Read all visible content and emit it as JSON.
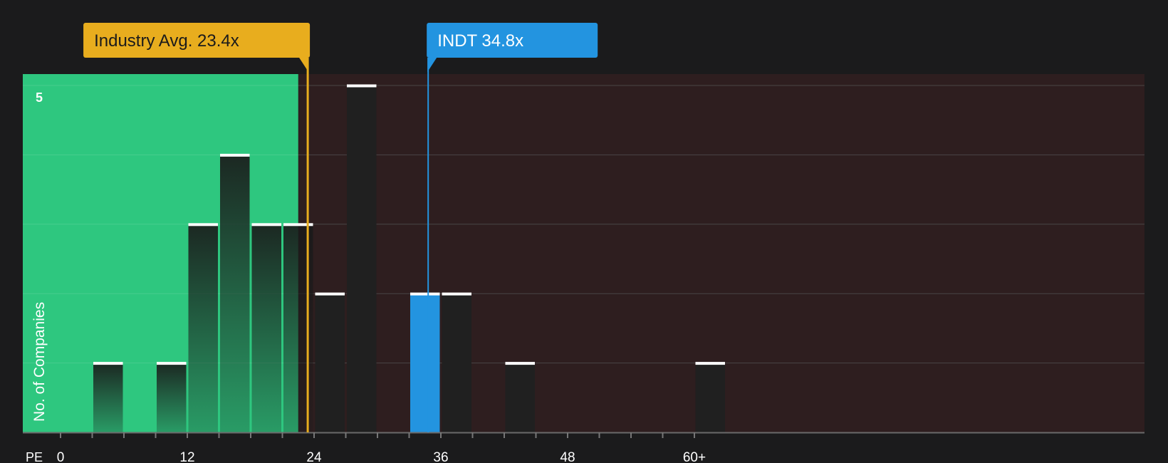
{
  "chart_data": {
    "type": "bar",
    "ylabel": "No. of Companies",
    "xaxis_prefix": "PE",
    "x_ticks": [
      {
        "value": 0,
        "label": "0"
      },
      {
        "value": 12,
        "label": "12"
      },
      {
        "value": 24,
        "label": "24"
      },
      {
        "value": 36,
        "label": "36"
      },
      {
        "value": 48,
        "label": "48"
      },
      {
        "value": 60,
        "label": "60+"
      }
    ],
    "y_ticks": [
      {
        "value": 5,
        "label": "5"
      }
    ],
    "xlim": [
      -2,
      61.5
    ],
    "ylim": [
      0,
      5.15
    ],
    "bins": [
      {
        "start": 3,
        "end": 6,
        "count": 1
      },
      {
        "start": 9,
        "end": 12,
        "count": 1
      },
      {
        "start": 12,
        "end": 15,
        "count": 3
      },
      {
        "start": 15,
        "end": 18,
        "count": 4
      },
      {
        "start": 18,
        "end": 21,
        "count": 3
      },
      {
        "start": 21,
        "end": 24,
        "count": 3
      },
      {
        "start": 24,
        "end": 27,
        "count": 2
      },
      {
        "start": 27,
        "end": 30,
        "count": 5
      },
      {
        "start": 33,
        "end": 36,
        "count": 2,
        "highlight": true
      },
      {
        "start": 36,
        "end": 39,
        "count": 2
      },
      {
        "start": 42,
        "end": 45,
        "count": 1
      },
      {
        "start": 60,
        "end": 63,
        "count": 1
      }
    ],
    "fair_range_end": 22.5,
    "markers": [
      {
        "name": "industry-average",
        "label": "Industry Avg. 23.4x",
        "value": 23.4,
        "color": "#e8ad1e"
      },
      {
        "name": "company",
        "label": "INDT 34.8x",
        "value": 34.8,
        "color": "#2394e0"
      }
    ]
  },
  "colors": {
    "background": "#1b1b1c",
    "undervalued_region": "#2ec77f",
    "overvalued_region": "#2e1e1f",
    "bar_dark": "#202020",
    "bar_highlight": "#2394e0",
    "bar_top": "#ffffff",
    "grid": "#555555",
    "text": "#ffffff"
  }
}
